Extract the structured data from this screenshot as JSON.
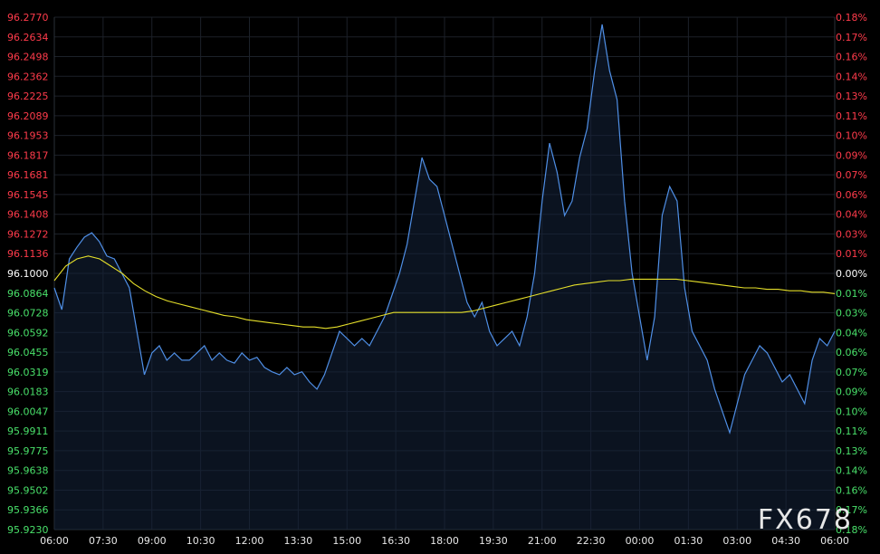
{
  "chart_data": {
    "type": "line",
    "watermark": "FX678",
    "colors": {
      "background": "#000000",
      "price_line": "#4f8fe6",
      "average_line": "#e6e02a",
      "up_label": "#ff3b4b",
      "down_label": "#49e06a",
      "grid": "#1c2129"
    },
    "y_left_ticks": [
      "96.2770",
      "96.2634",
      "96.2498",
      "96.2362",
      "96.2225",
      "96.2089",
      "96.1953",
      "96.1817",
      "96.1681",
      "96.1545",
      "96.1408",
      "96.1272",
      "96.1136",
      "96.1000",
      "96.0864",
      "96.0728",
      "96.0592",
      "96.0455",
      "96.0319",
      "96.0183",
      "96.0047",
      "95.9911",
      "95.9775",
      "95.9638",
      "95.9502",
      "95.9366",
      "95.9230"
    ],
    "y_right_ticks": [
      "0.18%",
      "0.17%",
      "0.16%",
      "0.14%",
      "0.13%",
      "0.11%",
      "0.10%",
      "0.09%",
      "0.07%",
      "0.06%",
      "0.04%",
      "0.03%",
      "0.01%",
      "0.00%",
      "0.01%",
      "0.03%",
      "0.04%",
      "0.06%",
      "0.07%",
      "0.09%",
      "0.10%",
      "0.11%",
      "0.13%",
      "0.14%",
      "0.16%",
      "0.17%",
      "0.18%"
    ],
    "x_ticks": [
      "06:00",
      "07:30",
      "09:00",
      "10:30",
      "12:00",
      "13:30",
      "15:00",
      "16:30",
      "18:00",
      "19:30",
      "21:00",
      "22:30",
      "00:00",
      "01:30",
      "03:00",
      "04:30",
      "06:00"
    ],
    "ylim": [
      95.923,
      96.277
    ],
    "reference": 96.1,
    "series": [
      {
        "values": [
          96.09,
          96.075,
          96.11,
          96.118,
          96.125,
          96.128,
          96.122,
          96.112,
          96.11,
          96.1,
          96.09,
          96.06,
          96.03,
          96.045,
          96.05,
          96.04,
          96.045,
          96.04,
          96.04,
          96.045,
          96.05,
          96.04,
          96.045,
          96.04,
          96.038,
          96.045,
          96.04,
          96.042,
          96.035,
          96.032,
          96.03,
          96.035,
          96.03,
          96.032,
          96.025,
          96.02,
          96.03,
          96.045,
          96.06,
          96.055,
          96.05,
          96.055,
          96.05,
          96.06,
          96.07,
          96.085,
          96.1,
          96.12,
          96.15,
          96.18,
          96.165,
          96.16,
          96.14,
          96.12,
          96.1,
          96.08,
          96.07,
          96.08,
          96.06,
          96.05,
          96.055,
          96.06,
          96.05,
          96.07,
          96.1,
          96.15,
          96.19,
          96.17,
          96.14,
          96.15,
          96.18,
          96.2,
          96.24,
          96.272,
          96.24,
          96.22,
          96.15,
          96.1,
          96.07,
          96.04,
          96.07,
          96.14,
          96.16,
          96.15,
          96.09,
          96.06,
          96.05,
          96.04,
          96.02,
          96.005,
          95.99,
          96.01,
          96.03,
          96.04,
          96.05,
          96.045,
          96.035,
          96.025,
          96.03,
          96.02,
          96.01,
          96.04,
          96.055,
          96.05,
          96.06
        ]
      },
      {
        "values": [
          96.095,
          96.105,
          96.11,
          96.112,
          96.11,
          96.105,
          96.1,
          96.093,
          96.088,
          96.084,
          96.081,
          96.079,
          96.077,
          96.075,
          96.073,
          96.071,
          96.07,
          96.068,
          96.067,
          96.066,
          96.065,
          96.064,
          96.063,
          96.063,
          96.062,
          96.063,
          96.065,
          96.067,
          96.069,
          96.071,
          96.073,
          96.073,
          96.073,
          96.073,
          96.073,
          96.073,
          96.073,
          96.074,
          96.076,
          96.078,
          96.08,
          96.082,
          96.084,
          96.086,
          96.088,
          96.09,
          96.092,
          96.093,
          96.094,
          96.095,
          96.095,
          96.096,
          96.096,
          96.096,
          96.096,
          96.096,
          96.095,
          96.094,
          96.093,
          96.092,
          96.091,
          96.09,
          96.09,
          96.089,
          96.089,
          96.088,
          96.088,
          96.087,
          96.087,
          96.086
        ]
      }
    ]
  }
}
